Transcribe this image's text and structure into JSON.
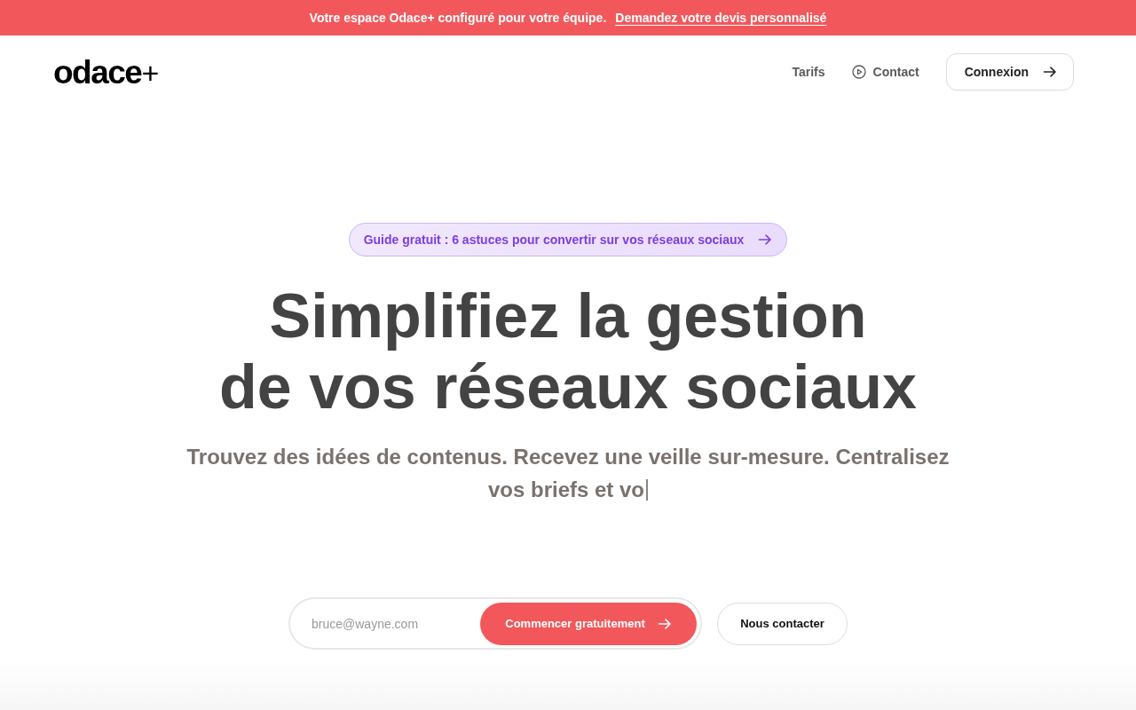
{
  "announcement": {
    "text": "Votre espace Odace+ configuré pour votre équipe.",
    "link": "Demandez votre devis personnalisé"
  },
  "navbar": {
    "logo": {
      "name": "odace",
      "suffix": "+"
    },
    "links": [
      {
        "label": "Tarifs",
        "kind": "plain"
      },
      {
        "label": "Contact",
        "kind": "video"
      }
    ],
    "login_button": "Connexion"
  },
  "hero": {
    "promo_badge": "Guide gratuit : 6 astuces pour convertir sur vos réseaux sociaux",
    "title_lines": [
      "Simplifiez la gestion",
      "de vos réseaux sociaux"
    ],
    "subtitle": "Trouvez des idées de contenus. Recevez une veille sur-mesure. Centralisez vos briefs et vo",
    "typing_cursor": true
  },
  "signup": {
    "email": {
      "placeholder": "bruce@wayne.com"
    },
    "submit_button": "Commencer gratuitement",
    "contact_button": "Nous contacter"
  }
}
